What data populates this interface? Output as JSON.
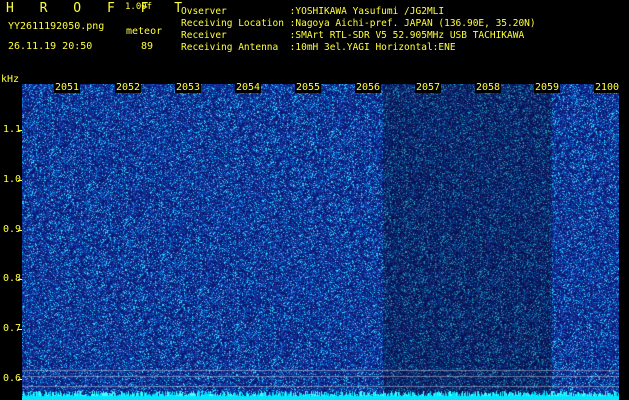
{
  "header": {
    "title": "H R O F F T",
    "version": "1.00f",
    "filename": "YY2611192050.png",
    "meteor_label": "meteor",
    "datetime": "26.11.19 20:50",
    "meteor_count": "89"
  },
  "info_lines": [
    "Ovserver           :YOSHIKAWA Yasufumi /JG2MLI",
    "Receiving Location :Nagoya Aichi-pref. JAPAN (136.90E, 35.20N)",
    "Receiver           :SMArt RTL-SDR V5 52.905MHz USB TACHIKAWA",
    "Receiving Antenna  :10mH 3el.YAGI Horizontal:ENE"
  ],
  "axis": {
    "unit": "kHz",
    "y_labels": [
      "1.1",
      "1.0",
      "0.9",
      "0.8",
      "0.7",
      "0.6"
    ],
    "x_labels": [
      "2051",
      "2052",
      "2053",
      "2054",
      "2055",
      "2056",
      "2057",
      "2058",
      "2059",
      "2100"
    ]
  },
  "colors": {
    "text": "#ffff3c",
    "background": "#000000",
    "spectrum_base": "#1a2c9a",
    "spectrum_noise": "#00c8ff",
    "baseline": "#00e0ff"
  }
}
